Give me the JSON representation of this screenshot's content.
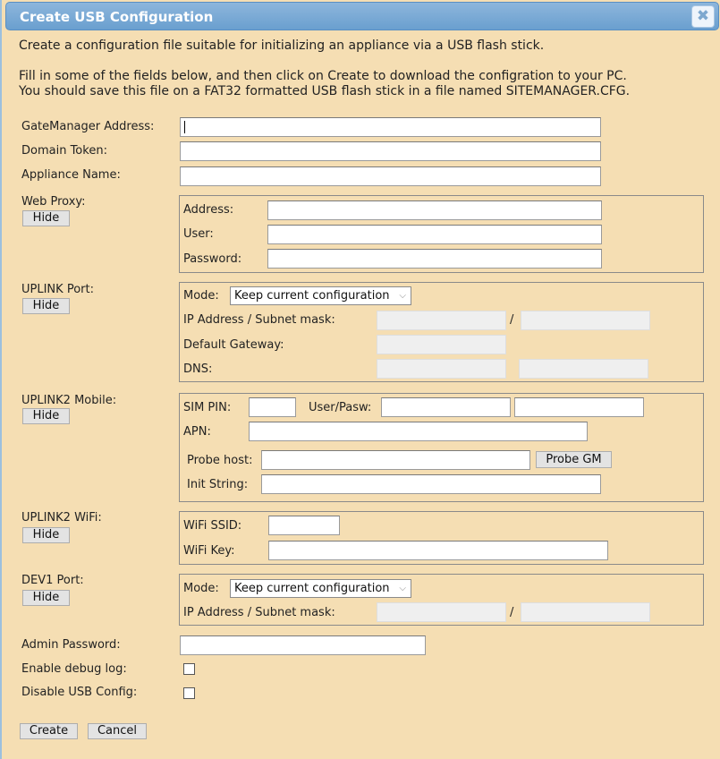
{
  "dialog": {
    "title": "Create USB Configuration",
    "close_icon": "close-icon",
    "intro_line1": "Create a configuration file suitable for initializing an appliance via a USB flash stick.",
    "intro_line2": "Fill in some of the fields below, and then click on Create to download the configration to your PC.",
    "intro_line3": "You should save this file on a FAT32 formatted USB flash stick in a file named SITEMANAGER.CFG."
  },
  "fields": {
    "gatemanager_address": {
      "label": "GateManager Address:",
      "value": ""
    },
    "domain_token": {
      "label": "Domain Token:",
      "value": ""
    },
    "appliance_name": {
      "label": "Appliance Name:",
      "value": ""
    }
  },
  "web_proxy": {
    "label": "Web Proxy:",
    "hide_label": "Hide",
    "address_label": "Address:",
    "user_label": "User:",
    "password_label": "Password:"
  },
  "uplink_port": {
    "label": "UPLINK Port:",
    "hide_label": "Hide",
    "mode_label": "Mode:",
    "mode_value": "Keep current configuration",
    "ip_label": "IP Address / Subnet mask:",
    "separator": "/",
    "gateway_label": "Default Gateway:",
    "dns_label": "DNS:"
  },
  "uplink2_mobile": {
    "label": "UPLINK2 Mobile:",
    "hide_label": "Hide",
    "sim_pin_label": "SIM PIN:",
    "user_pasw_label": "User/Pasw:",
    "apn_label": "APN:",
    "probe_host_label": "Probe host:",
    "probe_button": "Probe GM",
    "init_string_label": "Init String:"
  },
  "uplink2_wifi": {
    "label": "UPLINK2 WiFi:",
    "hide_label": "Hide",
    "ssid_label": "WiFi SSID:",
    "key_label": "WiFi Key:"
  },
  "dev1_port": {
    "label": "DEV1 Port:",
    "hide_label": "Hide",
    "mode_label": "Mode:",
    "mode_value": "Keep current configuration",
    "ip_label": "IP Address / Subnet mask:",
    "separator": "/"
  },
  "admin": {
    "password_label": "Admin Password:",
    "debug_label": "Enable debug log:",
    "debug_checked": false,
    "disable_usb_label": "Disable USB Config:",
    "disable_usb_checked": false
  },
  "actions": {
    "create_label": "Create",
    "cancel_label": "Cancel"
  }
}
